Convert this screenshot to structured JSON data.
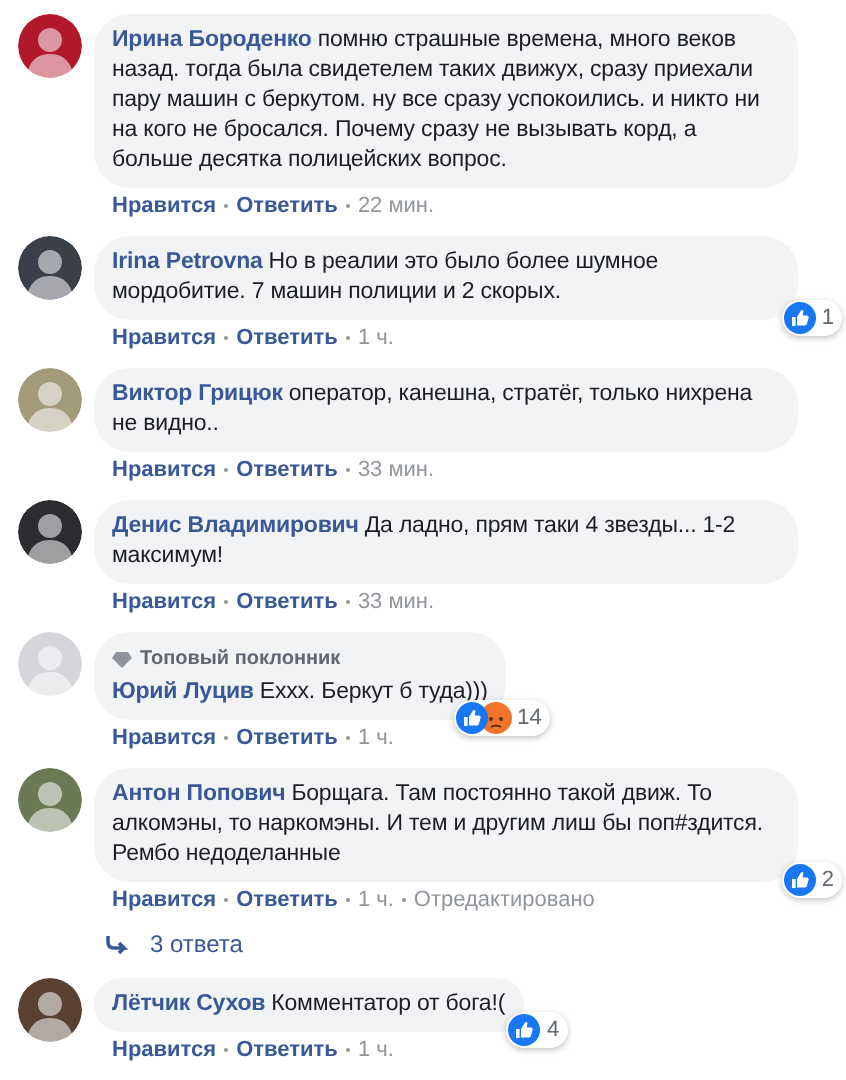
{
  "comments": [
    {
      "name": "Ирина Бороденко",
      "text": "помню страшные времена, много веков назад. тогда была свидетелем таких движух, сразу приехали пару машин с беркутом. ну все сразу успокоились. и никто ни на кого не бросался. Почему сразу не вызывать корд, а больше десятка полицейских вопрос.",
      "actions": [
        {
          "kind": "like",
          "label": "Нравится"
        },
        {
          "kind": "reply",
          "label": "Ответить"
        },
        {
          "kind": "time",
          "label": "22 мин."
        }
      ]
    },
    {
      "name": "Irina Petrovna",
      "text": "Но в реалии это было более шумное мордобитие. 7 машин полиции и 2 скорых.",
      "reactions": {
        "icons": [
          {
            "kind": "like"
          }
        ],
        "count": "1"
      },
      "actions": [
        {
          "kind": "like",
          "label": "Нравится"
        },
        {
          "kind": "reply",
          "label": "Ответить"
        },
        {
          "kind": "time",
          "label": "1 ч."
        }
      ]
    },
    {
      "name": "Виктор Грицюк",
      "text": "оператор, канешна, стратёг, только нихрена не видно..",
      "actions": [
        {
          "kind": "like",
          "label": "Нравится"
        },
        {
          "kind": "reply",
          "label": "Ответить"
        },
        {
          "kind": "time",
          "label": "33 мин."
        }
      ]
    },
    {
      "name": "Денис Владимирович",
      "text": "Да ладно, прям таки 4 звезды... 1-2 максимум!",
      "actions": [
        {
          "kind": "like",
          "label": "Нравится"
        },
        {
          "kind": "reply",
          "label": "Ответить"
        },
        {
          "kind": "time",
          "label": "33 мин."
        }
      ]
    },
    {
      "name": "Юрий Луцив",
      "badge": "Топовый поклонник",
      "text": "Ехxx. Беркут б туда)))",
      "reactions": {
        "icons": [
          {
            "kind": "like"
          },
          {
            "kind": "angry"
          }
        ],
        "count": "14"
      },
      "actions": [
        {
          "kind": "like",
          "label": "Нравится"
        },
        {
          "kind": "reply",
          "label": "Ответить"
        },
        {
          "kind": "time",
          "label": "1 ч."
        }
      ]
    },
    {
      "name": "Антон Попович",
      "text": "Борщага. Там постоянно такой движ. То алкомэны, то наркомэны. И тем и другим лиш бы поп#здится. Рембо недоделанные",
      "reactions": {
        "icons": [
          {
            "kind": "like"
          }
        ],
        "count": "2"
      },
      "actions": [
        {
          "kind": "like",
          "label": "Нравится"
        },
        {
          "kind": "reply",
          "label": "Ответить"
        },
        {
          "kind": "time",
          "label": "1 ч."
        },
        {
          "kind": "edited",
          "label": "Отредактировано"
        }
      ],
      "replies": "3 ответа"
    },
    {
      "name": "Лётчик Сухов",
      "text": "Комментатор от бога!(",
      "reactions": {
        "icons": [
          {
            "kind": "like"
          }
        ],
        "count": "4"
      },
      "actions": [
        {
          "kind": "like",
          "label": "Нравится"
        },
        {
          "kind": "reply",
          "label": "Ответить"
        },
        {
          "kind": "time",
          "label": "1 ч."
        }
      ]
    }
  ]
}
